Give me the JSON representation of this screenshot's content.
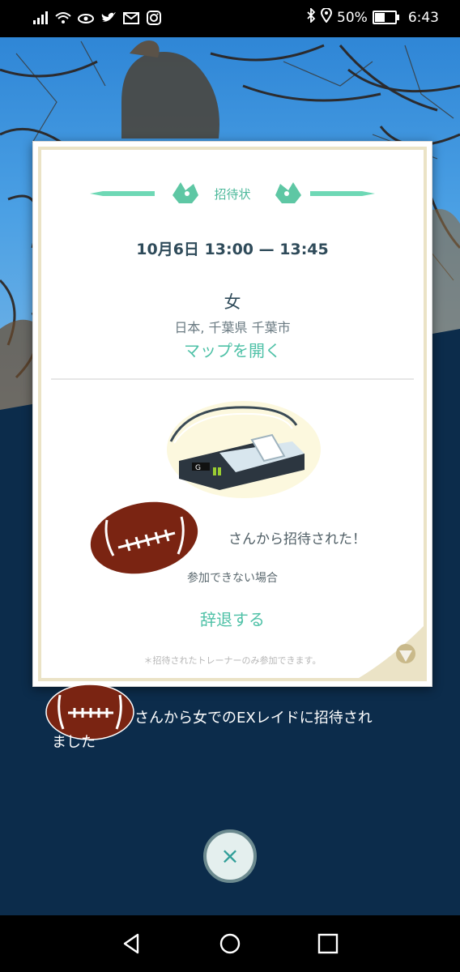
{
  "status_bar": {
    "battery_text": "50%",
    "battery_level": 0.5,
    "time": "6:43",
    "left_icons": [
      "signal-icon",
      "wifi-icon",
      "eye-icon",
      "twitter-icon",
      "gmail-icon",
      "instagram-icon"
    ],
    "right_icons": [
      "bluetooth-icon",
      "location-icon",
      "battery-icon"
    ]
  },
  "invite_card": {
    "header_title": "招待状",
    "date_time": "10月6日  13:00  —  13:45",
    "gym_name": "女",
    "location": "日本, 千葉県 千葉市",
    "map_link": "マップを開く",
    "invited_by_text": "さんから招待された！",
    "cannot_attend_text": "参加できない場合",
    "decline_button": "辞退する",
    "note": "＊招待されたトレーナーのみ参加できます。"
  },
  "notification_text_1": "さんから女でのEXレイドに招待され",
  "notification_text_2": "ました",
  "close_button_label": "×",
  "colors": {
    "accent": "#4fc1a7",
    "navy_background": "#0c2c4b",
    "card_border": "#ebe3c6",
    "sticker_brown": "#7a2412"
  },
  "nav_bar": {
    "icons": [
      "back-icon",
      "home-icon",
      "recents-icon"
    ]
  }
}
